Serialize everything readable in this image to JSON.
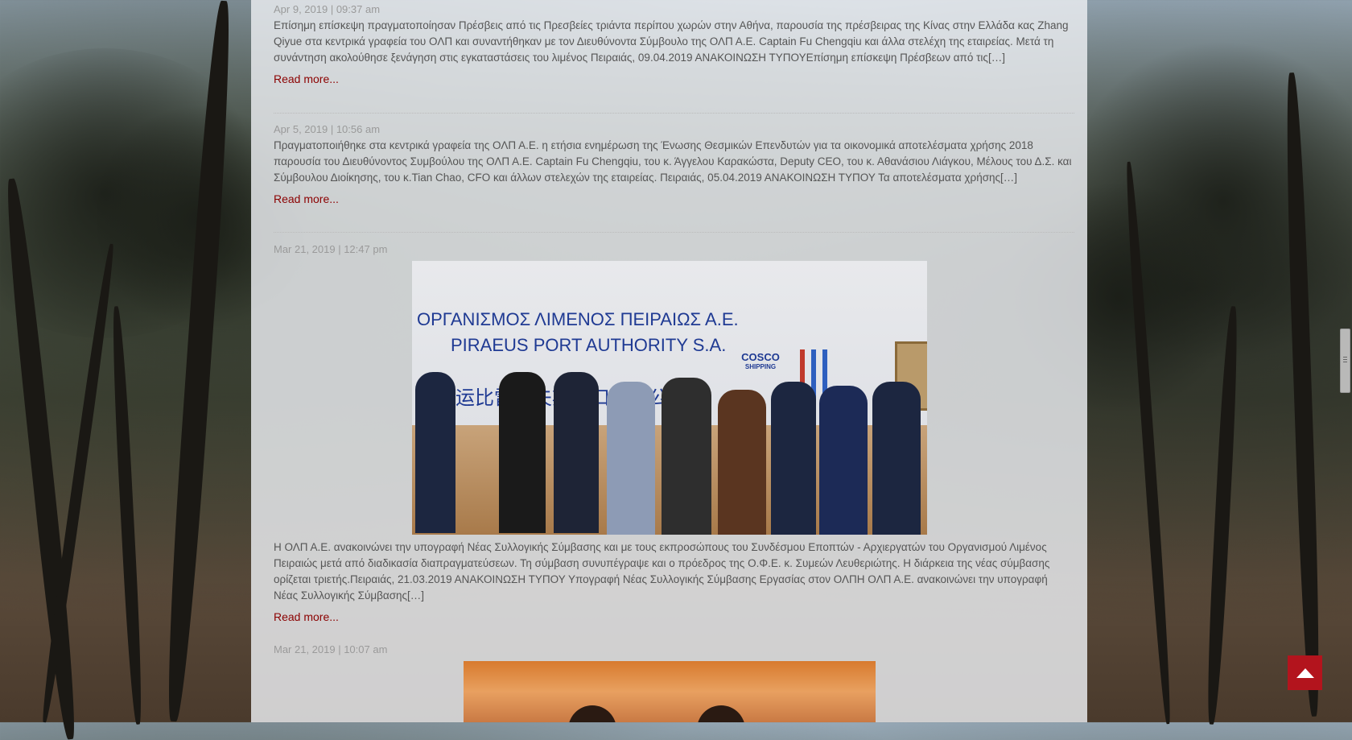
{
  "posts": [
    {
      "date": "Apr 9, 2019 | 09:37 am",
      "excerpt": "Επίσημη επίσκεψη πραγματοποίησαν Πρέσβεις από τις Πρεσβείες τριάντα περίπου χωρών στην Αθήνα, παρουσία της πρέσβειρας της Κίνας στην Ελλάδα κας Zhang Qiyue στα κεντρικά γραφεία του ΟΛΠ και συναντήθηκαν με τον Διευθύνοντα Σύμβουλο της ΟΛΠ Α.Ε. Captain Fu Chengqiu και άλλα στελέχη της εταιρείας. Μετά τη συνάντηση ακολούθησε ξενάγηση στις εγκαταστάσεις του λιμένος Πειραιάς, 09.04.2019 ΑΝΑΚΟΙΝΩΣΗ ΤΥΠΟΥΕπίσημη επίσκεψη Πρέσβεων από τις[…]",
      "read_more": "Read more..."
    },
    {
      "date": "Apr 5, 2019 | 10:56 am",
      "excerpt": "Πραγματοποιήθηκε στα κεντρικά γραφεία της ΟΛΠ Α.Ε. η ετήσια ενημέρωση της Ένωσης Θεσμικών Επενδυτών για τα οικονομικά αποτελέσματα χρήσης 2018 παρουσία του Διευθύνοντος Συμβούλου της ΟΛΠ Α.Ε. Captain Fu Chengqiu, του κ. Άγγελου Καρακώστα, Deputy CEO, του κ. Αθανάσιου Λιάγκου, Μέλους του Δ.Σ. και Σύμβουλου Διοίκησης, του κ.Tian Chao, CFO και άλλων στελεχών της εταιρείας. Πειραιάς, 05.04.2019 ΑΝΑΚΟΙΝΩΣΗ ΤΥΠΟΥ Τα αποτελέσματα χρήσης[…]",
      "read_more": "Read more..."
    },
    {
      "date": "Mar 21, 2019 | 12:47 pm",
      "photo_sign_line1": "ΟΡΓΑΝΙΣΜΟΣ ΛΙΜΕΝΟΣ ΠΕΙΡΑΙΩΣ Α.Ε.",
      "photo_sign_line2": "PIRAEUS PORT AUTHORITY S.A.",
      "photo_sign_line3": "远海运比雷埃夫斯港口有限公司",
      "photo_logo_top": "COSCO",
      "photo_logo_bottom": "SHIPPING",
      "excerpt": "Η ΟΛΠ Α.Ε. ανακοινώνει την υπογραφή Νέας Συλλογικής Σύμβασης και με τους εκπροσώπους του Συνδέσμου Εποπτών - Αρχιεργατών του Οργανισμού Λιμένος Πειραιώς μετά από διαδικασία διαπραγματεύσεων. Τη σύμβαση συνυπέγραψε και ο πρόεδρος της Ο.Φ.Ε. κ. Συμεών Λευθεριώτης. Η διάρκεια της νέας σύμβασης ορίζεται τριετής.Πειραιάς, 21.03.2019 ΑΝΑΚΟΙΝΩΣΗ ΤΥΠΟΥ Υπογραφή Νέας Συλλογικής Σύμβασης Εργασίας στον ΟΛΠΗ ΟΛΠ Α.Ε. ανακοινώνει την υπογραφή Νέας Συλλογικής Σύμβασης[…]",
      "read_more": "Read more..."
    },
    {
      "date": "Mar 21, 2019 | 10:07 am"
    }
  ],
  "colors": {
    "accent": "#8b0000",
    "to_top_button": "#b3141d"
  },
  "icons": {
    "to_top": "chevron-up-icon"
  }
}
